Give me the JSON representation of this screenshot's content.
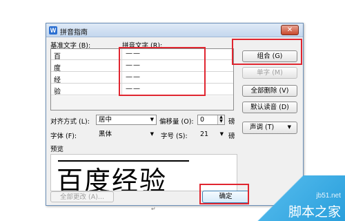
{
  "dialog": {
    "title": "拼音指南",
    "app_icon": "W",
    "close_glyph": "✕"
  },
  "grid": {
    "base_header": "基准文字 (B):",
    "pinyin_header": "拼音文字 (R):",
    "rows": [
      {
        "base": "百",
        "pinyin": "——"
      },
      {
        "base": "度",
        "pinyin": "——"
      },
      {
        "base": "经",
        "pinyin": "——"
      },
      {
        "base": "验",
        "pinyin": "——"
      },
      {
        "base": "",
        "pinyin": ""
      }
    ]
  },
  "buttons": {
    "combine": "组合 (G)",
    "single": "单字 (M)",
    "clear_all": "全部删除 (V)",
    "default_reading": "默认读音 (D)",
    "tone": "声调 (T)",
    "tone_arrow": "▼",
    "change_all": "全部更改 (A)...",
    "ok": "确定"
  },
  "options": {
    "alignment_label": "对齐方式 (L):",
    "alignment_value": "居中",
    "offset_label": "偏移量 (O):",
    "offset_value": "0",
    "offset_unit": "磅",
    "font_label": "字体 (F):",
    "font_value": "黑体",
    "size_label": "字号 (S):",
    "size_value": "21",
    "size_unit": "磅"
  },
  "preview": {
    "label": "预览",
    "text": "百度经验"
  },
  "page": {
    "para_mark": "↵"
  },
  "watermark": {
    "line1": "jb51.net",
    "line2": "脚本之家"
  },
  "colors": {
    "highlight": "#e0252f",
    "title_gradient_top": "#dfeaf6",
    "close_button": "#c8482c",
    "watermark_blue": "#2a9fdc"
  }
}
